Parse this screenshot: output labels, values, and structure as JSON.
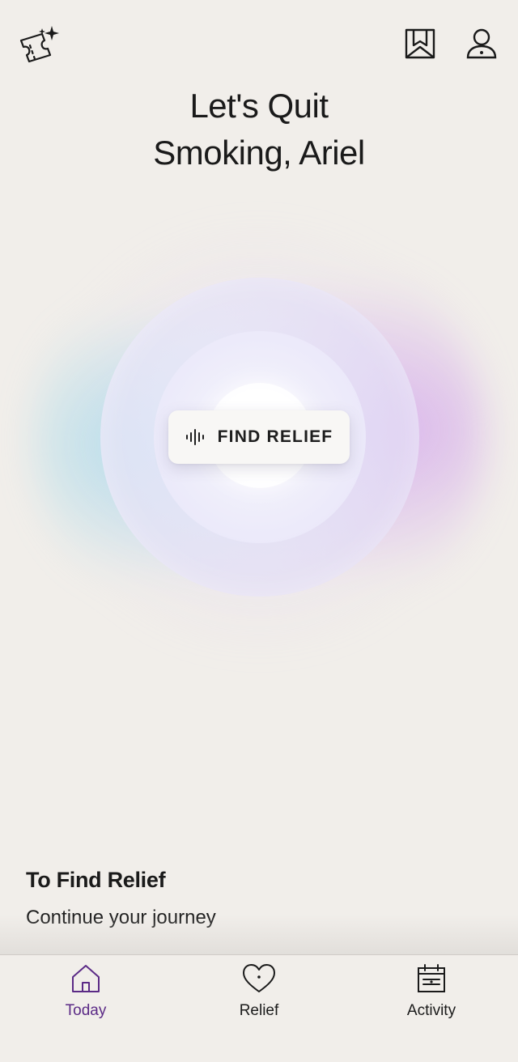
{
  "header": {
    "greeting_line1": "Let's Quit",
    "greeting_line2": "Smoking, Ariel",
    "icons": {
      "rewards": "ticket-sparkle-icon",
      "bookmark": "bookmark-icon",
      "profile": "user-icon"
    }
  },
  "orb": {
    "button_label": "FIND RELIEF",
    "button_icon": "audio-wave-icon"
  },
  "section": {
    "title": "To Find Relief",
    "subtitle": "Continue your journey"
  },
  "nav": {
    "active_color": "#5B2A86",
    "items": [
      {
        "label": "Today",
        "icon": "home-icon",
        "active": true
      },
      {
        "label": "Relief",
        "icon": "heart-icon",
        "active": false
      },
      {
        "label": "Activity",
        "icon": "calendar-icon",
        "active": false
      }
    ]
  },
  "colors": {
    "background": "#F1EEEA",
    "text": "#1A1A1A",
    "orb_cyan": "#82D2EB",
    "orb_purple": "#CD96EB"
  }
}
